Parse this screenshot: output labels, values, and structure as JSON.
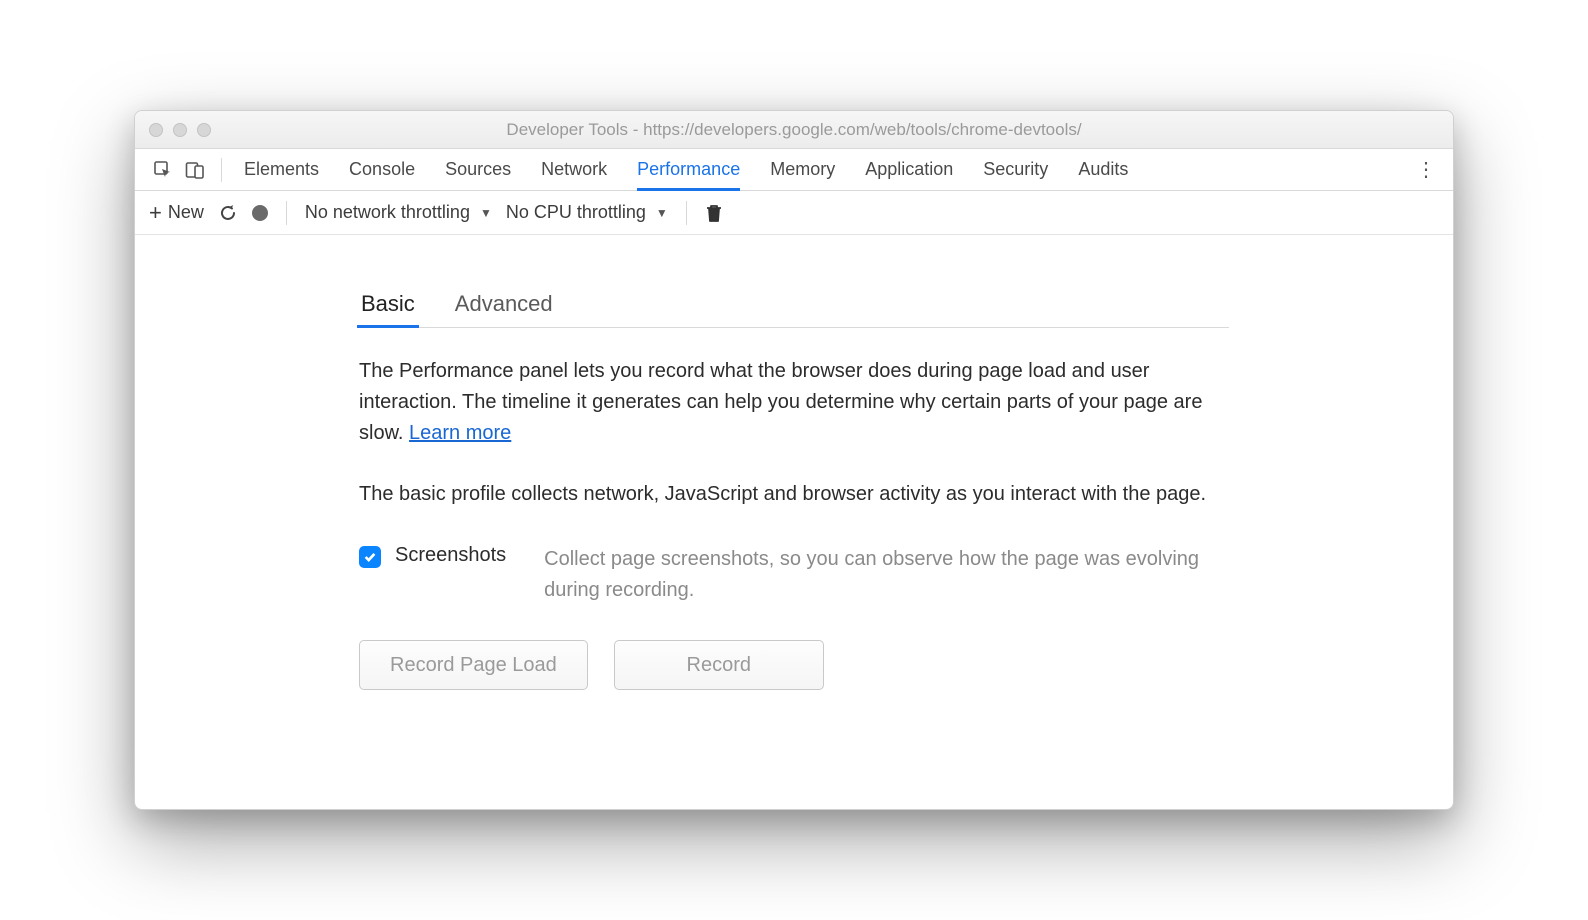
{
  "titlebar": {
    "title": "Developer Tools - https://developers.google.com/web/tools/chrome-devtools/"
  },
  "tabs": {
    "items": [
      "Elements",
      "Console",
      "Sources",
      "Network",
      "Performance",
      "Memory",
      "Application",
      "Security",
      "Audits"
    ],
    "active_index": 4
  },
  "toolbar": {
    "new_label": "New",
    "network_throttling": "No network throttling",
    "cpu_throttling": "No CPU throttling"
  },
  "subtabs": {
    "items": [
      "Basic",
      "Advanced"
    ],
    "active_index": 0
  },
  "description": {
    "p1": "The Performance panel lets you record what the browser does during page load and user interaction. The timeline it generates can help you determine why certain parts of your page are slow.  ",
    "learn_more": "Learn more",
    "p2": "The basic profile collects network, JavaScript and browser activity as you interact with the page."
  },
  "option": {
    "label": "Screenshots",
    "desc": "Collect page screenshots, so you can observe how the page was evolving during recording.",
    "checked": true
  },
  "buttons": {
    "record_page_load": "Record Page Load",
    "record": "Record"
  }
}
